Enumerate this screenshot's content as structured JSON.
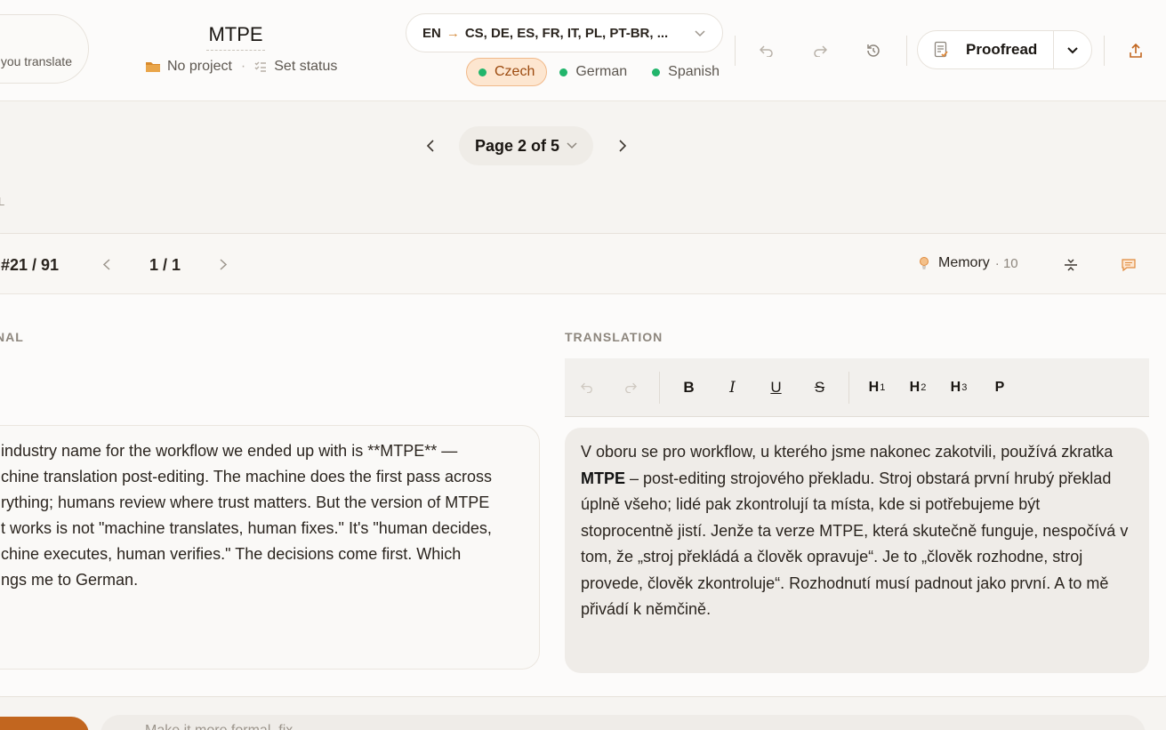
{
  "header": {
    "hint_pill": "you translate",
    "doc_title": "MTPE",
    "project": "No project",
    "status": "Set status",
    "lang_source": "EN",
    "lang_targets": "CS, DE, ES, FR, IT, PL, PT-BR, ...",
    "lang_tabs": [
      {
        "label": "Czech",
        "active": true
      },
      {
        "label": "German",
        "active": false
      },
      {
        "label": "Spanish",
        "active": false
      }
    ],
    "proofread_label": "Proofread"
  },
  "pagination": {
    "page_label": "Page 2 of 5"
  },
  "side_label": "L",
  "segment": {
    "counter": "#21 / 91",
    "sub_counter": "1 / 1",
    "memory_label": "Memory",
    "memory_count": "· 10",
    "original_label": "NAL",
    "translation_label": "TRANSLATION",
    "original_lines": [
      "industry name for the workflow we ended up with is **MTPE** —",
      "chine translation post-editing. The machine does the first pass across",
      "rything; humans review where trust matters. But the version of MTPE",
      "t works is not \"machine translates, human fixes.\" It's \"human decides,",
      "chine executes, human verifies.\" The decisions come first. Which",
      "ngs me to German."
    ],
    "translation_intro": "V oboru se pro workflow, u kterého jsme nakonec zakotvili, používá zkratka",
    "translation_bold": "MTPE",
    "translation_rest": "– post-editing strojového překladu. Stroj obstará první hrubý překlad úplně všeho; lidé pak zkontrolují ta místa, kde si potřebujeme být stoprocentně jistí. Jenže ta verze MTPE, která skutečně funguje, nespočívá v tom, že „stroj překládá a člověk opravuje“. Je to „člověk rozhodne, stroj provede, člověk zkontroluje“. Rozhodnutí musí padnout jako první. A to mě přivádí k němčině."
  },
  "editor_toolbar": {
    "bold": "B",
    "italic": "I",
    "underline": "U",
    "strike": "S",
    "h1": "H",
    "h2": "H",
    "h3": "H",
    "h1_sub": "1",
    "h2_sub": "2",
    "h3_sub": "3",
    "paragraph": "P"
  },
  "bottom": {
    "input_text": "Make it more formal, fix..."
  },
  "colors": {
    "accent": "#c2661f",
    "active_tab_bg": "#fde6d0",
    "status_green": "#22b56b"
  },
  "icons": [
    "folder-icon",
    "status-list-icon",
    "chevron-down-icon",
    "undo-icon",
    "redo-icon",
    "history-icon",
    "proofread-doc-icon",
    "export-icon",
    "chevron-left-icon",
    "chevron-right-icon",
    "lightbulb-icon",
    "collapse-icon",
    "comment-icon"
  ]
}
